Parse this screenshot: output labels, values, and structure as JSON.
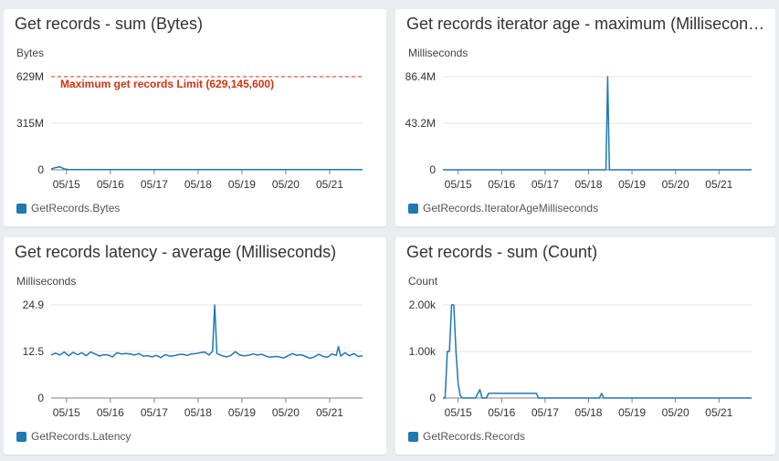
{
  "colors": {
    "series": "#1f77b4",
    "annotation": "#d13212",
    "grid": "#e6e6e6",
    "axis": "#7f7f7f"
  },
  "chart_data": [
    {
      "type": "line",
      "title": "Get records - sum (Bytes)",
      "ylabel": "Bytes",
      "ylim": [
        0,
        629000000
      ],
      "y_ticks": [
        {
          "value": 0,
          "label": "0"
        },
        {
          "value": 315000000,
          "label": "315M"
        },
        {
          "value": 629000000,
          "label": "629M"
        }
      ],
      "x_ticks": [
        "05/15",
        "05/16",
        "05/17",
        "05/18",
        "05/19",
        "05/20",
        "05/21"
      ],
      "xlim": [
        14.65,
        21.75
      ],
      "annotation": {
        "label": "Maximum get records Limit (629,145,600)",
        "value": 629145600
      },
      "series": [
        {
          "name": "GetRecords.Bytes",
          "x": [
            14.65,
            14.75,
            14.85,
            14.95,
            15.05,
            15.15,
            21.75
          ],
          "y": [
            5000000,
            15000000,
            20000000,
            6000000,
            2000000,
            1500000,
            1500000
          ]
        }
      ]
    },
    {
      "type": "line",
      "title": "Get records iterator age - maximum (Milliseconds)",
      "ylabel": "Milliseconds",
      "ylim": [
        0,
        86400000
      ],
      "y_ticks": [
        {
          "value": 0,
          "label": "0"
        },
        {
          "value": 43200000,
          "label": "43.2M"
        },
        {
          "value": 86400000,
          "label": "86.4M"
        }
      ],
      "x_ticks": [
        "05/15",
        "05/16",
        "05/17",
        "05/18",
        "05/19",
        "05/20",
        "05/21"
      ],
      "xlim": [
        14.65,
        21.75
      ],
      "series": [
        {
          "name": "GetRecords.IteratorAgeMilliseconds",
          "x": [
            14.65,
            18.4,
            18.44,
            18.48,
            21.75
          ],
          "y": [
            0,
            0,
            86400000,
            0,
            0
          ]
        }
      ]
    },
    {
      "type": "line",
      "title": "Get records latency - average (Milliseconds)",
      "ylabel": "Milliseconds",
      "ylim": [
        0,
        24.9
      ],
      "y_ticks": [
        {
          "value": 0,
          "label": "0"
        },
        {
          "value": 12.5,
          "label": "12.5"
        },
        {
          "value": 24.9,
          "label": "24.9"
        }
      ],
      "x_ticks": [
        "05/15",
        "05/16",
        "05/17",
        "05/18",
        "05/19",
        "05/20",
        "05/21"
      ],
      "xlim": [
        14.65,
        21.75
      ],
      "series": [
        {
          "name": "GetRecords.Latency",
          "x": [
            14.65,
            14.75,
            14.85,
            14.95,
            15.05,
            15.15,
            15.25,
            15.35,
            15.45,
            15.55,
            15.65,
            15.75,
            15.85,
            15.95,
            16.05,
            16.15,
            16.25,
            16.35,
            16.45,
            16.55,
            16.65,
            16.75,
            16.85,
            16.95,
            17.05,
            17.15,
            17.25,
            17.35,
            17.45,
            17.55,
            17.65,
            17.75,
            17.85,
            17.95,
            18.05,
            18.15,
            18.25,
            18.33,
            18.38,
            18.43,
            18.55,
            18.65,
            18.75,
            18.85,
            18.95,
            19.05,
            19.15,
            19.25,
            19.35,
            19.45,
            19.55,
            19.65,
            19.75,
            19.85,
            19.95,
            20.05,
            20.15,
            20.25,
            20.35,
            20.45,
            20.55,
            20.65,
            20.75,
            20.85,
            20.95,
            21.05,
            21.15,
            21.2,
            21.25,
            21.35,
            21.45,
            21.55,
            21.65,
            21.75
          ],
          "y": [
            11.5,
            12,
            11.5,
            12.3,
            11.3,
            12.2,
            11.6,
            12.1,
            11.3,
            12.3,
            11.8,
            11.2,
            11.6,
            11.5,
            11.0,
            12.1,
            11.8,
            11.9,
            11.8,
            11.5,
            11.9,
            11.2,
            11.3,
            11.0,
            11.4,
            10.8,
            11.6,
            11.2,
            11.3,
            11.6,
            11.7,
            11.4,
            11.8,
            11.9,
            12.1,
            12.3,
            11.5,
            12.5,
            24.9,
            11.9,
            11.3,
            11.0,
            11.4,
            12.4,
            11.5,
            11.3,
            11.4,
            11.8,
            11.5,
            11.7,
            11.2,
            10.9,
            11.1,
            11.0,
            10.7,
            11.3,
            11.9,
            11.4,
            11.6,
            11.1,
            10.6,
            11.0,
            11.7,
            11.1,
            10.9,
            11.8,
            11.4,
            13.8,
            11.2,
            12.1,
            11.3,
            11.9,
            11.1,
            11.3
          ]
        }
      ]
    },
    {
      "type": "line",
      "title": "Get records - sum (Count)",
      "ylabel": "Count",
      "ylim": [
        0,
        2000
      ],
      "y_ticks": [
        {
          "value": 0,
          "label": "0"
        },
        {
          "value": 1000,
          "label": "1.00k"
        },
        {
          "value": 2000,
          "label": "2.00k"
        }
      ],
      "x_ticks": [
        "05/15",
        "05/16",
        "05/17",
        "05/18",
        "05/19",
        "05/20",
        "05/21"
      ],
      "xlim": [
        14.65,
        21.75
      ],
      "series": [
        {
          "name": "GetRecords.Records",
          "x": [
            14.65,
            14.7,
            14.75,
            14.8,
            14.85,
            14.9,
            14.95,
            15.0,
            15.05,
            15.1,
            15.2,
            15.4,
            15.5,
            15.55,
            15.6,
            15.65,
            15.7,
            15.75,
            16.2,
            16.6,
            16.8,
            16.85,
            16.9,
            17.0,
            17.4,
            18.25,
            18.3,
            18.35,
            18.4,
            21.75
          ],
          "y": [
            0,
            0,
            1000,
            1000,
            2000,
            2000,
            1000,
            300,
            50,
            0,
            0,
            0,
            180,
            0,
            0,
            0,
            100,
            100,
            100,
            100,
            100,
            0,
            0,
            0,
            0,
            0,
            100,
            0,
            0,
            0
          ]
        }
      ]
    }
  ]
}
